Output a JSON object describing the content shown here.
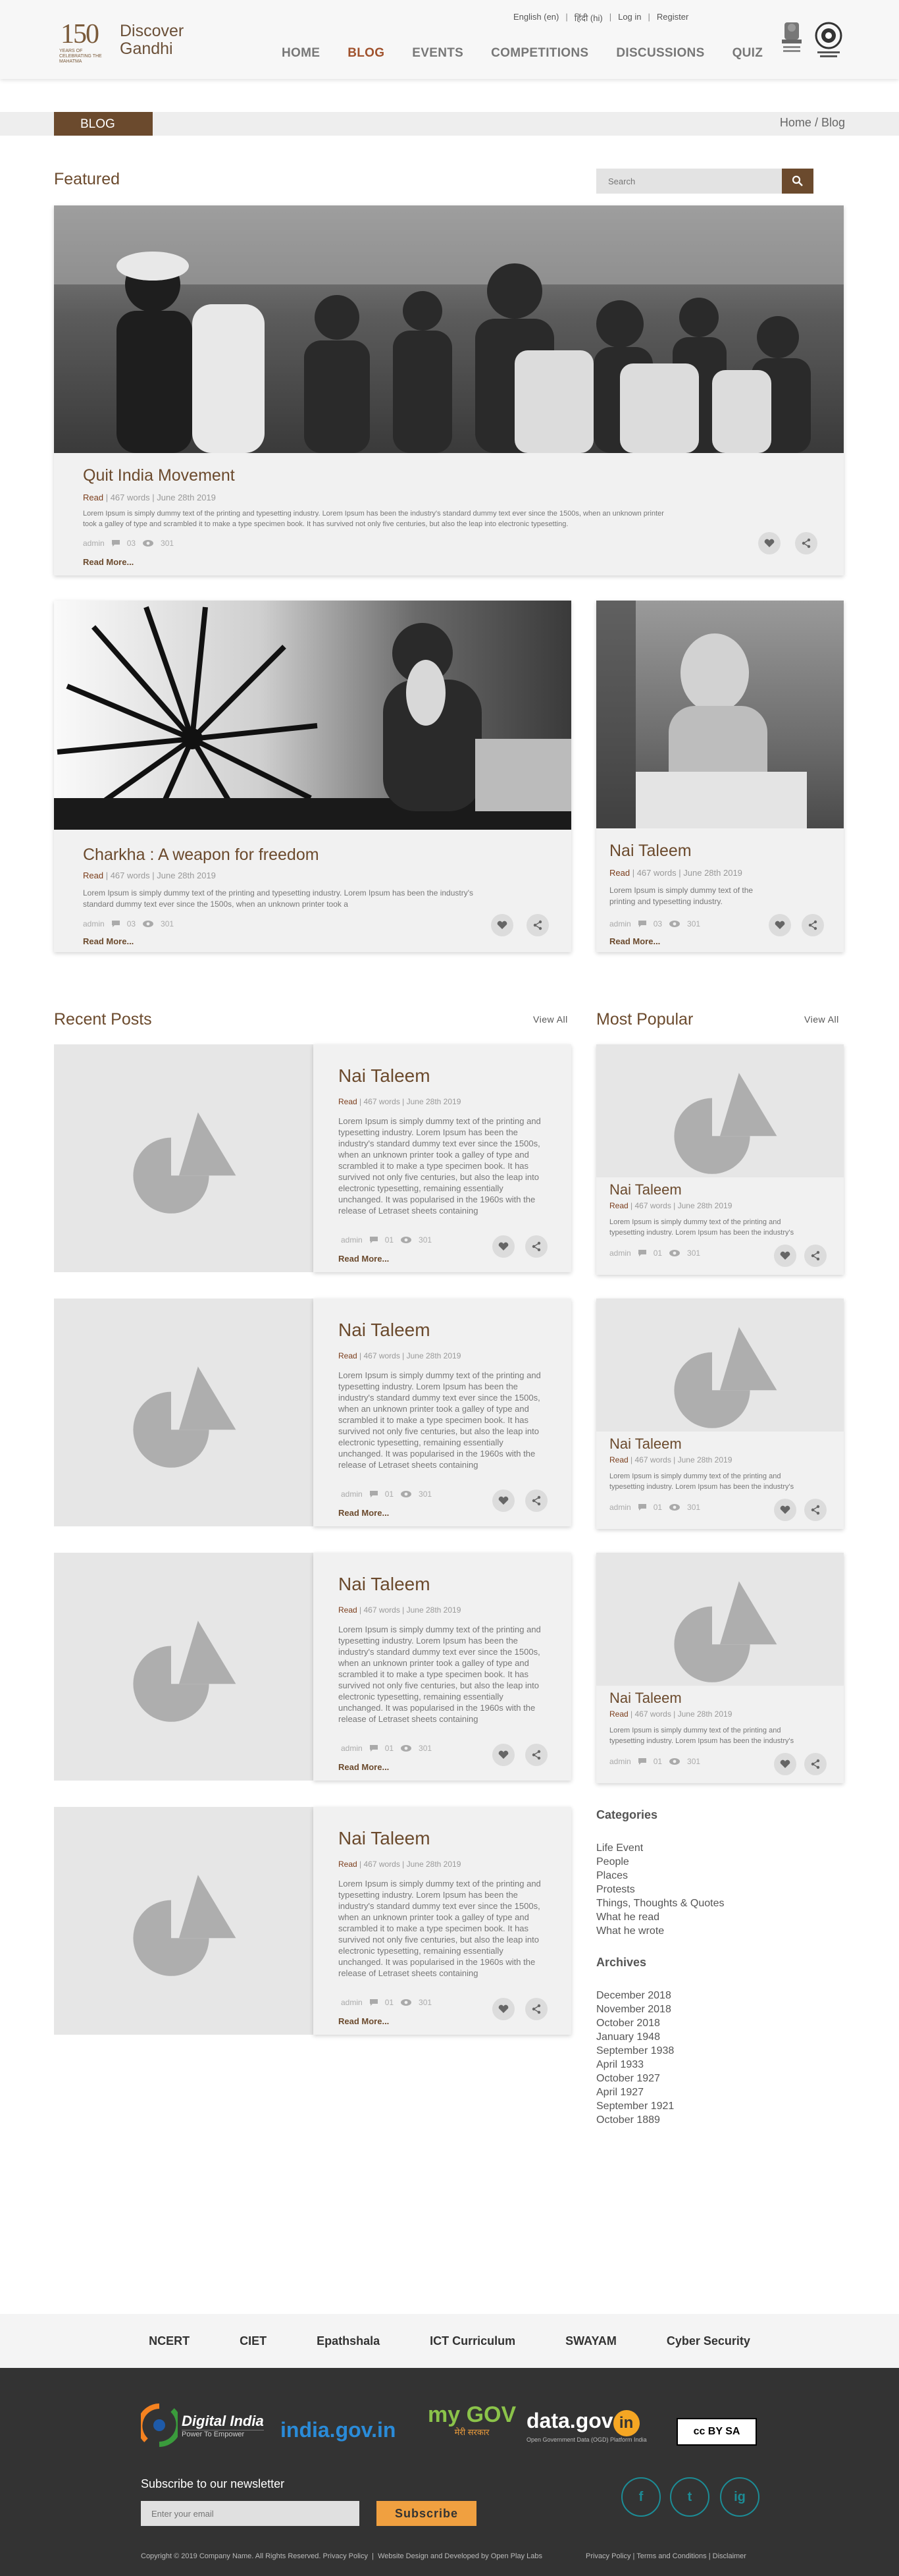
{
  "header": {
    "logo_number": "150",
    "logo_tagline": "YEARS OF CELEBRATING THE MAHATMA",
    "logo_title_line1": "Discover",
    "logo_title_line2": "Gandhi",
    "lang_en": "English (en)",
    "lang_hi": "हिंदी (hi)",
    "login": "Log in",
    "register": "Register",
    "nav": [
      "HOME",
      "BLOG",
      "EVENTS",
      "COMPETITIONS",
      "DISCUSSIONS",
      "QUIZ"
    ],
    "active_nav": "BLOG"
  },
  "breadcrumb": {
    "tag": "BLOG",
    "home": "Home",
    "sep": "/",
    "current": "Blog"
  },
  "featured": {
    "title": "Featured",
    "search_placeholder": "Search",
    "main": {
      "title": "Quit India Movement",
      "read": "Read",
      "meta": "467 words | June 28th 2019",
      "excerpt": "Lorem Ipsum is simply dummy text of the printing and typesetting industry. Lorem Ipsum has been the industry's standard dummy text ever since the 1500s, when an unknown printer took a galley of type and scrambled it to make a type specimen book. It has survived not only five centuries, but also the leap into electronic typesetting.",
      "author": "admin",
      "comments": "03",
      "views": "301",
      "more": "Read More..."
    },
    "second": {
      "title": "Charkha : A weapon for freedom",
      "read": "Read",
      "meta": "467 words | June 28th 2019",
      "excerpt": "Lorem Ipsum is simply dummy text of the printing and typesetting industry. Lorem Ipsum has been the industry's standard dummy text ever since the 1500s, when an unknown printer took a",
      "author": "admin",
      "comments": "03",
      "views": "301",
      "more": "Read More..."
    },
    "third": {
      "title": "Nai Taleem",
      "read": "Read",
      "meta": "467 words | June 28th 2019",
      "excerpt": "Lorem Ipsum is simply dummy text of the printing and typesetting industry.",
      "author": "admin",
      "comments": "03",
      "views": "301",
      "more": "Read More..."
    }
  },
  "recent": {
    "title": "Recent Posts",
    "view_all": "View All",
    "posts": [
      {
        "title": "Nai Taleem",
        "read": "Read",
        "meta": "467 words | June 28th 2019",
        "excerpt": "Lorem Ipsum is simply dummy text of the printing and typesetting industry. Lorem Ipsum has been the industry's standard dummy text ever since the 1500s, when an unknown printer took a galley of type and scrambled it to make a type specimen book. It has survived not only five centuries, but also the leap into electronic typesetting, remaining essentially unchanged. It was popularised in the 1960s with the release of Letraset sheets containing",
        "author": "admin",
        "comments": "01",
        "views": "301",
        "more": "Read More..."
      },
      {
        "title": "Nai Taleem",
        "read": "Read",
        "meta": "467 words | June 28th 2019",
        "excerpt": "Lorem Ipsum is simply dummy text of the printing and typesetting industry. Lorem Ipsum has been the industry's standard dummy text ever since the 1500s, when an unknown printer took a galley of type and scrambled it to make a type specimen book. It has survived not only five centuries, but also the leap into electronic typesetting, remaining essentially unchanged. It was popularised in the 1960s with the release of Letraset sheets containing",
        "author": "admin",
        "comments": "01",
        "views": "301",
        "more": "Read More..."
      },
      {
        "title": "Nai Taleem",
        "read": "Read",
        "meta": "467 words | June 28th 2019",
        "excerpt": "Lorem Ipsum is simply dummy text of the printing and typesetting industry. Lorem Ipsum has been the industry's standard dummy text ever since the 1500s, when an unknown printer took a galley of type and scrambled it to make a type specimen book. It has survived not only five centuries, but also the leap into electronic typesetting, remaining essentially unchanged. It was popularised in the 1960s with the release of Letraset sheets containing",
        "author": "admin",
        "comments": "01",
        "views": "301",
        "more": "Read More..."
      },
      {
        "title": "Nai Taleem",
        "read": "Read",
        "meta": "467 words | June 28th 2019",
        "excerpt": "Lorem Ipsum is simply dummy text of the printing and typesetting industry. Lorem Ipsum has been the industry's standard dummy text ever since the 1500s, when an unknown printer took a galley of type and scrambled it to make a type specimen book. It has survived not only five centuries, but also the leap into electronic typesetting, remaining essentially unchanged. It was popularised in the 1960s with the release of Letraset sheets containing",
        "author": "admin",
        "comments": "01",
        "views": "301",
        "more": "Read More..."
      }
    ]
  },
  "popular": {
    "title": "Most Popular",
    "view_all": "View All",
    "posts": [
      {
        "title": "Nai Taleem",
        "read": "Read",
        "meta": "467 words | June 28th 2019",
        "excerpt": "Lorem Ipsum is simply dummy text of the printing and typesetting industry. Lorem Ipsum has been the industry's",
        "author": "admin",
        "comments": "01",
        "views": "301"
      },
      {
        "title": "Nai Taleem",
        "read": "Read",
        "meta": "467 words | June 28th 2019",
        "excerpt": "Lorem Ipsum is simply dummy text of the printing and typesetting industry. Lorem Ipsum has been the industry's",
        "author": "admin",
        "comments": "01",
        "views": "301"
      },
      {
        "title": "Nai Taleem",
        "read": "Read",
        "meta": "467 words | June 28th 2019",
        "excerpt": "Lorem Ipsum is simply dummy text of the printing and typesetting industry. Lorem Ipsum has been the industry's",
        "author": "admin",
        "comments": "01",
        "views": "301"
      }
    ]
  },
  "categories": {
    "title": "Categories",
    "items": [
      "Life Event",
      "People",
      "Places",
      "Protests",
      "Things, Thoughts & Quotes",
      "What he read",
      "What he wrote"
    ]
  },
  "archives": {
    "title": "Archives",
    "items": [
      "December 2018",
      "November 2018",
      "October 2018",
      "January 1948",
      "September 1938",
      "April 1933",
      "October 1927",
      "April 1927",
      "September 1921",
      "October 1889"
    ]
  },
  "partners": [
    "NCERT",
    "CIET",
    "Epathshala",
    "ICT Curriculum",
    "SWAYAM",
    "Cyber Security"
  ],
  "footer": {
    "digital_india": "Digital India",
    "digital_india_sub": "Power To Empower",
    "india_gov": "india.gov.in",
    "mygov": "my GOV",
    "mygov_sub": "मेरी सरकार",
    "datagov": "data.gov",
    "datagov_in": "in",
    "datagov_sub": "Open Government Data (OGD) Platform India",
    "cc": "cc BY SA",
    "newsletter_title": "Subscribe to our newsletter",
    "email_placeholder": "Enter your email",
    "subscribe": "Subscribe",
    "copyright": "Copyright © 2019 Company Name. All Rights Reserved. Privacy Policy",
    "designed": "Website Design and Developed by Open Play Labs",
    "privacy": "Privacy Policy",
    "terms": "Terms and Conditions",
    "disclaimer": "Disclaimer",
    "sep": "|",
    "facebook": "f",
    "twitter": "t",
    "instagram": "ig"
  },
  "colors": {
    "accent": "#6b4a2d",
    "nav_active": "#a0522d",
    "footer_bg": "#333333",
    "subscribe": "#f0a040",
    "social": "#1c8c96"
  }
}
